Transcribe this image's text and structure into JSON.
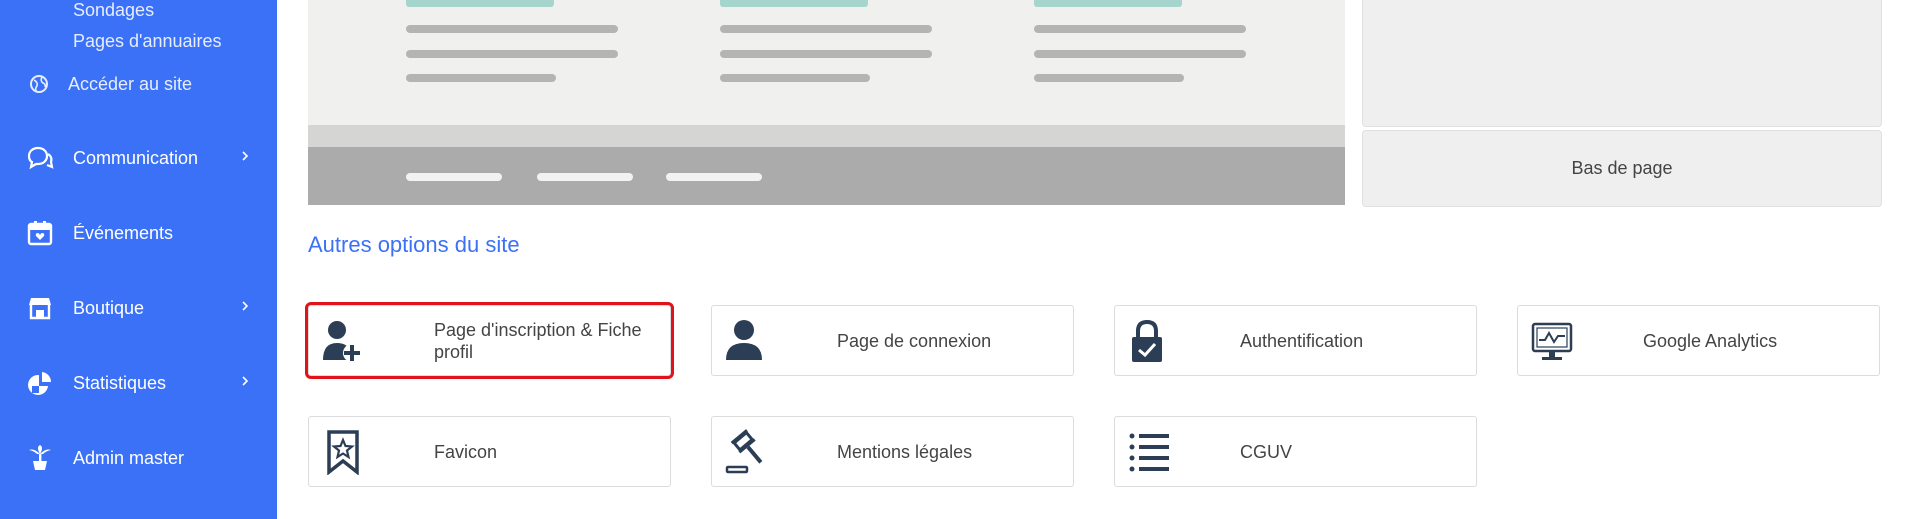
{
  "sidebar": {
    "sub_items": [
      "Sondages",
      "Pages d'annuaires"
    ],
    "site_link": "Accéder au site",
    "items": [
      {
        "label": "Communication",
        "icon": "chat-bubbles-icon",
        "has_chevron": true
      },
      {
        "label": "Événements",
        "icon": "calendar-icon",
        "has_chevron": false
      },
      {
        "label": "Boutique",
        "icon": "storefront-icon",
        "has_chevron": true
      },
      {
        "label": "Statistiques",
        "icon": "pie-chart-icon",
        "has_chevron": true
      },
      {
        "label": "Admin master",
        "icon": "palm-tree-icon",
        "has_chevron": false
      }
    ]
  },
  "layout_preview": {
    "bottom_box_label": "Bas de page"
  },
  "section": {
    "title": "Autres options du site"
  },
  "options": [
    {
      "label": "Page d'inscription & Fiche profil",
      "icon": "user-plus-icon",
      "selected": true
    },
    {
      "label": "Page de connexion",
      "icon": "user-icon",
      "selected": false
    },
    {
      "label": "Authentification",
      "icon": "padlock-check-icon",
      "selected": false
    },
    {
      "label": "Google Analytics",
      "icon": "monitor-chart-icon",
      "selected": false
    },
    {
      "label": "Favicon",
      "icon": "bookmark-star-icon",
      "selected": false
    },
    {
      "label": "Mentions légales",
      "icon": "gavel-icon",
      "selected": false
    },
    {
      "label": "CGUV",
      "icon": "list-icon",
      "selected": false
    }
  ],
  "colors": {
    "sidebar_bg": "#3b71f7",
    "accent": "#3b71f7",
    "highlight_border": "#e0121a",
    "icon_dark": "#2c3e55"
  }
}
